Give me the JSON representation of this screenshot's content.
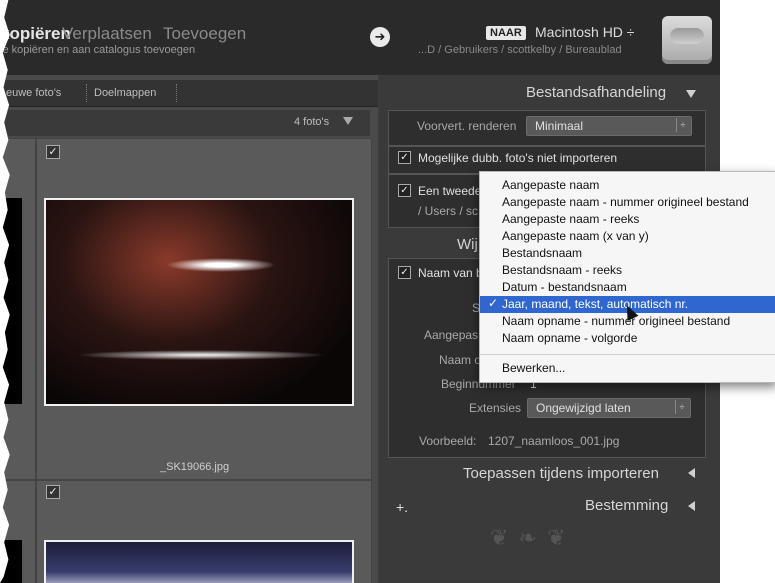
{
  "topbar": {
    "modes": [
      "kopiëren",
      "Verplaatsen",
      "Toevoegen"
    ],
    "subtitle": "ie kopiëren en aan catalogus toevoegen",
    "arrow_glyph": "➜",
    "destination_badge": "NAAR",
    "disk": "Macintosh HD ÷",
    "path": "...D / Gebruikers / scottkelby / Bureaublad"
  },
  "left": {
    "tabs": [
      "euwe foto's",
      "Doelmappen"
    ],
    "count": "4 foto's",
    "photos": [
      {
        "filename": "_SK19066.jpg",
        "checked": "✓"
      },
      {
        "filename": "",
        "checked": "✓"
      }
    ],
    "left_check": "✓"
  },
  "right": {
    "section_file_handling": "Bestandsafhandeling",
    "preview_render_label": "Voorvert. renderen",
    "preview_render_value": "Minimaal",
    "duplicates_label": "Mogelijke dubb. foto's niet importeren",
    "second_copy_label": "Een tweede",
    "second_copy_path": "/ Users / sc",
    "section_rename_partial": "Wij",
    "rename_label": "Naam van b",
    "template_label_partial": "S",
    "custom_label_partial": "Aangepas",
    "shoot_label_partial": "Naam o",
    "start_number_label": "Beginnummer",
    "start_number_value": "1",
    "extension_label": "Extensies",
    "extension_value": "Ongewijzigd laten",
    "example_label": "Voorbeeld:",
    "example_value": "1207_naamloos_001.jpg",
    "section_apply": "Toepassen tijdens importeren",
    "section_destination": "Bestemming",
    "plus": "+.",
    "ornament": "❦ ❧ ❦"
  },
  "dropdown": {
    "items": [
      "Aangepaste naam",
      "Aangepaste naam - nummer origineel bestand",
      "Aangepaste naam - reeks",
      "Aangepaste naam (x van y)",
      "Bestandsnaam",
      "Bestandsnaam - reeks",
      "Datum - bestandsnaam",
      "Jaar, maand, tekst, automatisch nr.",
      "Naam opname - nummer origineel bestand",
      "Naam opname - volgorde"
    ],
    "selected_check": "✓",
    "edit": "Bewerken..."
  }
}
